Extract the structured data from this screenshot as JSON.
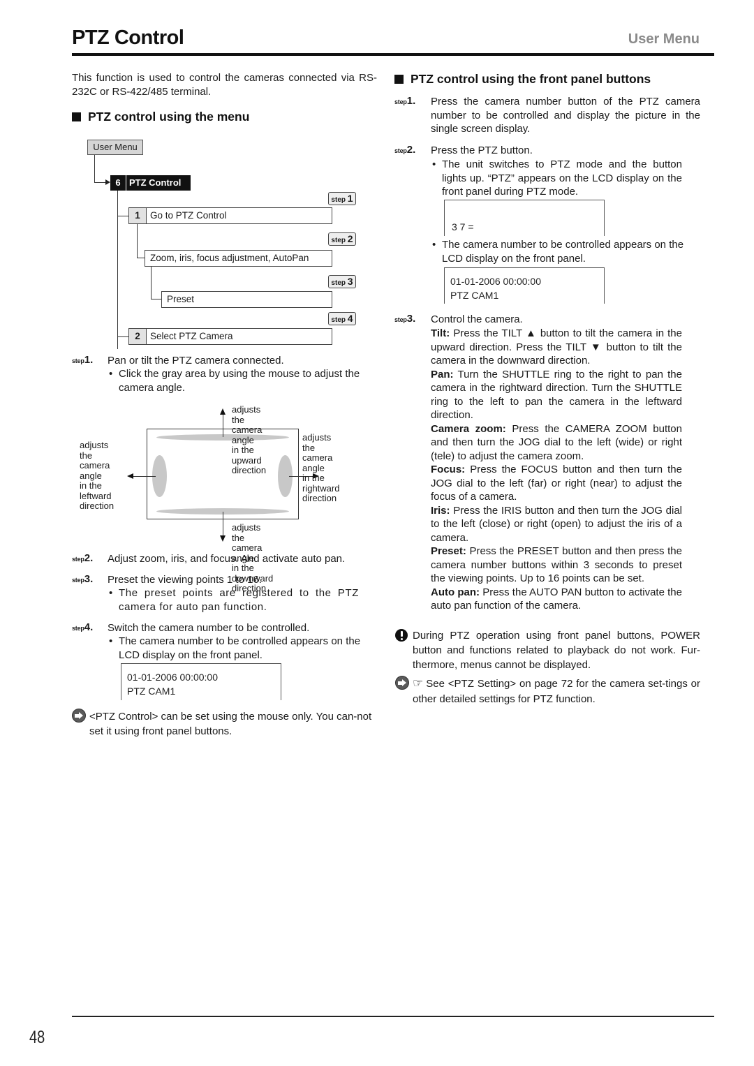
{
  "header": {
    "title": "PTZ Control",
    "section": "User Menu"
  },
  "intro": "This function is used to control the cameras connected via RS-232C or RS-422/485 terminal.",
  "menu_section": {
    "heading": "PTZ control using the menu",
    "tree": {
      "root": "User Menu",
      "node_num": "6",
      "node_label": "PTZ Control",
      "items": [
        {
          "num": "1",
          "label": "Go to PTZ Control",
          "step": "1"
        },
        {
          "num": "",
          "label": "Zoom, iris, focus adjustment, AutoPan",
          "step": "2"
        },
        {
          "num": "",
          "label": "Preset",
          "step": "3"
        },
        {
          "num": "2",
          "label": "Select PTZ Camera",
          "step": "4"
        }
      ],
      "step_word": "step"
    },
    "steps": [
      {
        "step": "1",
        "text": "Pan or tilt the PTZ camera connected.",
        "bullet": "Click the gray area by using the mouse to adjust the camera angle."
      },
      {
        "step": "2",
        "text": "Adjust zoom, iris, and focus. And activate auto pan."
      },
      {
        "step": "3",
        "text": "Preset the viewing points 1 to 16.",
        "bullet": "The preset points are registered to the PTZ camera for auto pan function."
      },
      {
        "step": "4",
        "text": "Switch the camera number to be controlled.",
        "bullet": "The camera number to be controlled appears on the LCD display on the front panel."
      }
    ],
    "diagram": {
      "up": [
        "adjusts the camera angle",
        "in the upward direction"
      ],
      "down": [
        "adjusts the camera angle",
        "in the downward direction"
      ],
      "left": [
        "adjusts the",
        "camera angle",
        "in the leftward",
        "direction"
      ],
      "right": [
        "adjusts the",
        "camera angle",
        "in the rightward",
        "direction"
      ]
    },
    "lcd": [
      "01-01-2006 00:00:00",
      "PTZ CAM1"
    ],
    "note": "<PTZ Control> can be set using the mouse only. You can-not set it using front panel buttons."
  },
  "panel_section": {
    "heading": "PTZ control using the front panel buttons",
    "step_word": "step",
    "steps": [
      {
        "step": "1",
        "text": "Press the camera number button of the PTZ camera number to be controlled and display the picture in the single screen display."
      },
      {
        "step": "2",
        "text": "Press the PTZ button.",
        "bullet1": "The unit switches to PTZ mode and the button lights up. “PTZ” appears on the LCD display on the front panel during PTZ mode.",
        "bullet2": "The camera number to be controlled appears on the LCD display on the front panel."
      },
      {
        "step": "3",
        "text": "Control the camera."
      }
    ],
    "lcd1": "3 7 =",
    "lcd2": [
      "01-01-2006 00:00:00",
      "PTZ CAM1"
    ],
    "controls": [
      {
        "label": "Tilt:",
        "text": "Press the TILT ▲ button to tilt the camera in the upward direction. Press the TILT ▼ button to tilt the camera in the downward direction."
      },
      {
        "label": "Pan:",
        "text": "Turn the SHUTTLE ring to the right to pan the camera in the rightward direction. Turn the SHUTTLE ring to the left to pan the camera in the leftward direction."
      },
      {
        "label": "Camera zoom:",
        "text": "Press the CAMERA ZOOM button and then turn the JOG dial to the left (wide) or right (tele) to adjust the camera zoom."
      },
      {
        "label": "Focus:",
        "text": "Press the FOCUS button and then turn the JOG dial to the left (far) or right (near) to adjust the focus of a camera."
      },
      {
        "label": "Iris:",
        "text": "Press the IRIS button and then turn the JOG dial to the left (close) or right (open) to adjust the iris of a camera."
      },
      {
        "label": "Preset:",
        "text": "Press the PRESET button and then press the camera number buttons within 3 seconds to preset the viewing points. Up to 16 points can be set."
      },
      {
        "label": "Auto pan:",
        "text": "Press the AUTO PAN button to activate the auto pan function of the camera."
      }
    ],
    "warning": "During PTZ operation using front panel buttons, POWER button and functions related to playback do not work. Fur-thermore, menus cannot be displayed.",
    "reference": "See <PTZ Setting> on page 72 for the camera set-tings or other detailed settings for PTZ function.",
    "reference_icon": "☞"
  },
  "footer": {
    "page_number": "48"
  }
}
